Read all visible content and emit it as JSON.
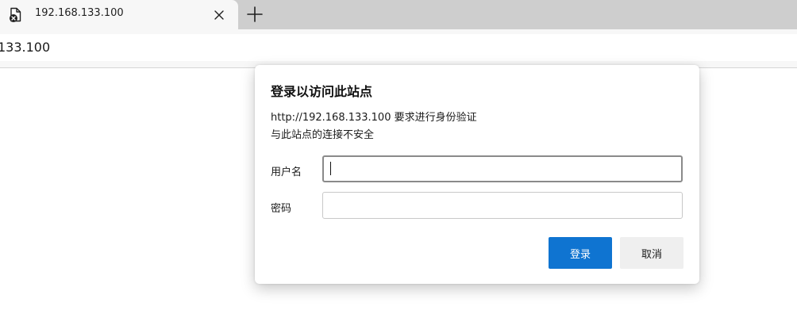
{
  "browser": {
    "tab": {
      "title": "192.168.133.100",
      "icon": "insecure-page-icon"
    },
    "close_tab_icon": "close-icon",
    "new_tab_icon": "plus-icon",
    "address_bar": {
      "url": "133.100"
    }
  },
  "auth_dialog": {
    "title": "登录以访问此站点",
    "message": "http://192.168.133.100 要求进行身份验证",
    "warning": "与此站点的连接不安全",
    "username_label": "用户名",
    "username_value": "",
    "password_label": "密码",
    "password_value": "",
    "login_button": "登录",
    "cancel_button": "取消"
  },
  "colors": {
    "primary_button": "#0f74d1",
    "secondary_button": "#efefef",
    "tab_strip": "#cecece"
  }
}
